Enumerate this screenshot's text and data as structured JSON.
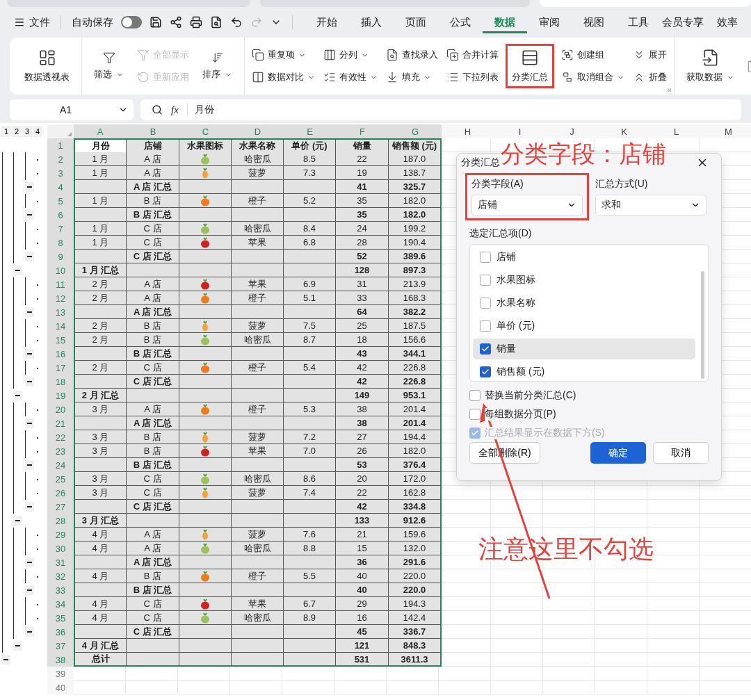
{
  "document_tabs": [
    {
      "selected": false
    },
    {
      "selected": false
    },
    {
      "selected": true
    }
  ],
  "menubar": {
    "file": "文件",
    "autosave": {
      "label": "自动保存",
      "on": false
    },
    "tabs": [
      {
        "label": "开始",
        "selected": false
      },
      {
        "label": "插入",
        "selected": false
      },
      {
        "label": "页面",
        "selected": false
      },
      {
        "label": "公式",
        "selected": false
      },
      {
        "label": "数据",
        "selected": true
      },
      {
        "label": "审阅",
        "selected": false
      },
      {
        "label": "视图",
        "selected": false
      },
      {
        "label": "工具",
        "selected": false
      },
      {
        "label": "会员专享",
        "selected": false
      },
      {
        "label": "效率",
        "selected": false
      }
    ]
  },
  "ribbon": [
    [
      {
        "kind": "large",
        "label": "数据透视表"
      }
    ],
    [
      {
        "kind": "large",
        "label": "筛选",
        "dropdown": true
      },
      {
        "kind": "stack",
        "items": [
          {
            "label": "全部显示",
            "disabled": true
          },
          {
            "label": "重新应用",
            "disabled": true
          }
        ]
      },
      {
        "kind": "large",
        "label": "排序",
        "dropdown": true
      }
    ],
    [
      {
        "kind": "stack",
        "items": [
          {
            "label": "重复项",
            "dropdown": true
          },
          {
            "label": "数据对比",
            "dropdown": true
          }
        ]
      },
      {
        "kind": "stack",
        "items": [
          {
            "label": "分列",
            "dropdown": true
          },
          {
            "label": "有效性",
            "dropdown": true
          }
        ]
      },
      {
        "kind": "stack",
        "items": [
          {
            "label": "查找录入"
          },
          {
            "label": "填充",
            "dropdown": true
          }
        ]
      },
      {
        "kind": "stack",
        "items": [
          {
            "label": "合并计算"
          },
          {
            "label": "下拉列表"
          }
        ]
      },
      {
        "kind": "large",
        "label": "分类汇总",
        "highlighted": true
      },
      {
        "kind": "stack",
        "items": [
          {
            "label": "创建组"
          },
          {
            "label": "取消组合",
            "dropdown": true
          }
        ]
      },
      {
        "kind": "stack",
        "items": [
          {
            "label": "展开"
          },
          {
            "label": "折叠"
          }
        ]
      }
    ],
    [
      {
        "kind": "large",
        "label": "获取数据",
        "dropdown": true
      }
    ]
  ],
  "formula_bar": {
    "cell": "A1",
    "fx": "fx",
    "formula": "月份"
  },
  "outline_levels": [
    "1",
    "2",
    "3",
    "4"
  ],
  "columns": [
    {
      "label": "A",
      "selected": true
    },
    {
      "label": "B",
      "selected": true
    },
    {
      "label": "C",
      "selected": true
    },
    {
      "label": "D",
      "selected": true
    },
    {
      "label": "E",
      "selected": true
    },
    {
      "label": "F",
      "selected": true
    },
    {
      "label": "G",
      "selected": true
    },
    {
      "label": "H",
      "selected": false
    },
    {
      "label": "I",
      "selected": false
    },
    {
      "label": "J",
      "selected": false
    },
    {
      "label": "K",
      "selected": false
    },
    {
      "label": "L",
      "selected": false
    },
    {
      "label": "M",
      "selected": false
    }
  ],
  "rows": [
    {
      "number": "1",
      "selected": true,
      "kind": "header",
      "active": true,
      "A": "月份",
      "B": "店铺",
      "C": "水果图标",
      "D": "水果名称",
      "E": "单价 (元)",
      "F": "销量",
      "G": "销售额 (元)"
    },
    {
      "number": "2",
      "selected": true,
      "kind": "data",
      "A": "1 月",
      "B": "A 店",
      "C": {
        "kind": "melon"
      },
      "D": "哈密瓜",
      "E": "8.5",
      "F": "22",
      "G": "187.0"
    },
    {
      "number": "3",
      "selected": true,
      "kind": "data",
      "A": "1 月",
      "B": "A 店",
      "C": {
        "kind": "pineapple"
      },
      "D": "菠萝",
      "E": "7.3",
      "F": "19",
      "G": "138.7"
    },
    {
      "number": "4",
      "selected": true,
      "kind": "store_total",
      "B": "A 店 汇总",
      "F": "41",
      "G": "325.7"
    },
    {
      "number": "5",
      "selected": true,
      "kind": "data",
      "A": "1 月",
      "B": "B 店",
      "C": {
        "kind": "orange"
      },
      "D": "橙子",
      "E": "5.2",
      "F": "35",
      "G": "182.0"
    },
    {
      "number": "6",
      "selected": true,
      "kind": "store_total",
      "B": "B 店 汇总",
      "F": "35",
      "G": "182.0"
    },
    {
      "number": "7",
      "selected": true,
      "kind": "data",
      "A": "1 月",
      "B": "C 店",
      "C": {
        "kind": "melon"
      },
      "D": "哈密瓜",
      "E": "8.4",
      "F": "24",
      "G": "199.2"
    },
    {
      "number": "8",
      "selected": true,
      "kind": "data",
      "A": "1 月",
      "B": "C 店",
      "C": {
        "kind": "apple"
      },
      "D": "苹果",
      "E": "6.8",
      "F": "28",
      "G": "190.4"
    },
    {
      "number": "9",
      "selected": true,
      "kind": "store_total",
      "B": "C 店 汇总",
      "F": "52",
      "G": "389.6"
    },
    {
      "number": "10",
      "selected": true,
      "kind": "month_total",
      "A": "1 月 汇总",
      "F": "128",
      "G": "897.3"
    },
    {
      "number": "11",
      "selected": true,
      "kind": "data",
      "A": "2 月",
      "B": "A 店",
      "C": {
        "kind": "apple"
      },
      "D": "苹果",
      "E": "6.9",
      "F": "31",
      "G": "213.9"
    },
    {
      "number": "12",
      "selected": true,
      "kind": "data",
      "A": "2 月",
      "B": "A 店",
      "C": {
        "kind": "orange"
      },
      "D": "橙子",
      "E": "5.1",
      "F": "33",
      "G": "168.3"
    },
    {
      "number": "13",
      "selected": true,
      "kind": "store_total",
      "B": "A 店 汇总",
      "F": "64",
      "G": "382.2"
    },
    {
      "number": "14",
      "selected": true,
      "kind": "data",
      "A": "2 月",
      "B": "B 店",
      "C": {
        "kind": "pineapple"
      },
      "D": "菠萝",
      "E": "7.5",
      "F": "25",
      "G": "187.5"
    },
    {
      "number": "15",
      "selected": true,
      "kind": "data",
      "A": "2 月",
      "B": "B 店",
      "C": {
        "kind": "melon"
      },
      "D": "哈密瓜",
      "E": "8.7",
      "F": "18",
      "G": "156.6"
    },
    {
      "number": "16",
      "selected": true,
      "kind": "store_total",
      "B": "B 店 汇总",
      "F": "43",
      "G": "344.1"
    },
    {
      "number": "17",
      "selected": true,
      "kind": "data",
      "A": "2 月",
      "B": "C 店",
      "C": {
        "kind": "orange"
      },
      "D": "橙子",
      "E": "5.4",
      "F": "42",
      "G": "226.8"
    },
    {
      "number": "18",
      "selected": true,
      "kind": "store_total",
      "B": "C 店 汇总",
      "F": "42",
      "G": "226.8"
    },
    {
      "number": "19",
      "selected": true,
      "kind": "month_total",
      "A": "2 月 汇总",
      "F": "149",
      "G": "953.1"
    },
    {
      "number": "20",
      "selected": true,
      "kind": "data",
      "A": "3 月",
      "B": "A 店",
      "C": {
        "kind": "orange"
      },
      "D": "橙子",
      "E": "5.3",
      "F": "38",
      "G": "201.4"
    },
    {
      "number": "21",
      "selected": true,
      "kind": "store_total",
      "B": "A 店 汇总",
      "F": "38",
      "G": "201.4"
    },
    {
      "number": "22",
      "selected": true,
      "kind": "data",
      "A": "3 月",
      "B": "B 店",
      "C": {
        "kind": "pineapple"
      },
      "D": "菠萝",
      "E": "7.2",
      "F": "27",
      "G": "194.4"
    },
    {
      "number": "23",
      "selected": true,
      "kind": "data",
      "A": "3 月",
      "B": "B 店",
      "C": {
        "kind": "apple"
      },
      "D": "苹果",
      "E": "7.0",
      "F": "26",
      "G": "182.0"
    },
    {
      "number": "24",
      "selected": true,
      "kind": "store_total",
      "B": "B 店 汇总",
      "F": "53",
      "G": "376.4"
    },
    {
      "number": "25",
      "selected": true,
      "kind": "data",
      "A": "3 月",
      "B": "C 店",
      "C": {
        "kind": "melon"
      },
      "D": "哈密瓜",
      "E": "8.6",
      "F": "20",
      "G": "172.0"
    },
    {
      "number": "26",
      "selected": true,
      "kind": "data",
      "A": "3 月",
      "B": "C 店",
      "C": {
        "kind": "pineapple"
      },
      "D": "菠萝",
      "E": "7.4",
      "F": "22",
      "G": "162.8"
    },
    {
      "number": "27",
      "selected": true,
      "kind": "store_total",
      "B": "C 店 汇总",
      "F": "42",
      "G": "334.8"
    },
    {
      "number": "28",
      "selected": true,
      "kind": "month_total",
      "A": "3 月 汇总",
      "F": "133",
      "G": "912.6"
    },
    {
      "number": "29",
      "selected": true,
      "kind": "data",
      "A": "4 月",
      "B": "A 店",
      "C": {
        "kind": "pineapple"
      },
      "D": "菠萝",
      "E": "7.6",
      "F": "21",
      "G": "159.6"
    },
    {
      "number": "30",
      "selected": true,
      "kind": "data",
      "A": "4 月",
      "B": "A 店",
      "C": {
        "kind": "melon"
      },
      "D": "哈密瓜",
      "E": "8.8",
      "F": "15",
      "G": "132.0"
    },
    {
      "number": "31",
      "selected": true,
      "kind": "store_total",
      "B": "A 店 汇总",
      "F": "36",
      "G": "291.6"
    },
    {
      "number": "32",
      "selected": true,
      "kind": "data",
      "A": "4 月",
      "B": "B 店",
      "C": {
        "kind": "orange"
      },
      "D": "橙子",
      "E": "5.5",
      "F": "40",
      "G": "220.0"
    },
    {
      "number": "33",
      "selected": true,
      "kind": "store_total",
      "B": "B 店 汇总",
      "F": "40",
      "G": "220.0"
    },
    {
      "number": "34",
      "selected": true,
      "kind": "data",
      "A": "4 月",
      "B": "C 店",
      "C": {
        "kind": "apple"
      },
      "D": "苹果",
      "E": "6.7",
      "F": "29",
      "G": "194.3"
    },
    {
      "number": "35",
      "selected": true,
      "kind": "data",
      "A": "4 月",
      "B": "C 店",
      "C": {
        "kind": "melon"
      },
      "D": "哈密瓜",
      "E": "8.9",
      "F": "16",
      "G": "142.4"
    },
    {
      "number": "36",
      "selected": true,
      "kind": "store_total",
      "B": "C 店 汇总",
      "F": "45",
      "G": "336.7"
    },
    {
      "number": "37",
      "selected": true,
      "kind": "month_total",
      "A": "4 月 汇总",
      "F": "121",
      "G": "848.3"
    },
    {
      "number": "38",
      "selected": true,
      "kind": "grand_total",
      "A": "总计",
      "F": "531",
      "G": "3611.3"
    },
    {
      "number": "39",
      "selected": false,
      "kind": "empty"
    },
    {
      "number": "40",
      "selected": false,
      "kind": "empty"
    }
  ],
  "dialog": {
    "title": "分类汇总",
    "category_field": {
      "label": "分类字段(A)",
      "value": "店铺",
      "highlighted": true
    },
    "method": {
      "label": "汇总方式(U)",
      "value": "求和"
    },
    "items_label": "选定汇总项(D)",
    "items": [
      {
        "label": "店铺",
        "checked": false,
        "selected": false
      },
      {
        "label": "水果图标",
        "checked": false,
        "selected": false
      },
      {
        "label": "水果名称",
        "checked": false,
        "selected": false
      },
      {
        "label": "单价 (元)",
        "checked": false,
        "selected": false
      },
      {
        "label": "销量",
        "checked": true,
        "selected": true
      },
      {
        "label": "销售额 (元)",
        "checked": true,
        "selected": false
      }
    ],
    "options": [
      {
        "label": "替换当前分类汇总(C)",
        "checked": false,
        "disabled": false
      },
      {
        "label": "每组数据分页(P)",
        "checked": false,
        "disabled": false
      },
      {
        "label": "汇总结果显示在数据下方(S)",
        "checked": true,
        "disabled": true
      }
    ],
    "buttons": [
      {
        "label": "全部删除(R)",
        "kind": "secondary"
      },
      {
        "label": "确定",
        "kind": "primary"
      },
      {
        "label": "取消",
        "kind": "secondary"
      }
    ]
  },
  "annotations": [
    {
      "text": "分类字段：店铺"
    },
    {
      "text": "注意这里不勾选"
    }
  ]
}
